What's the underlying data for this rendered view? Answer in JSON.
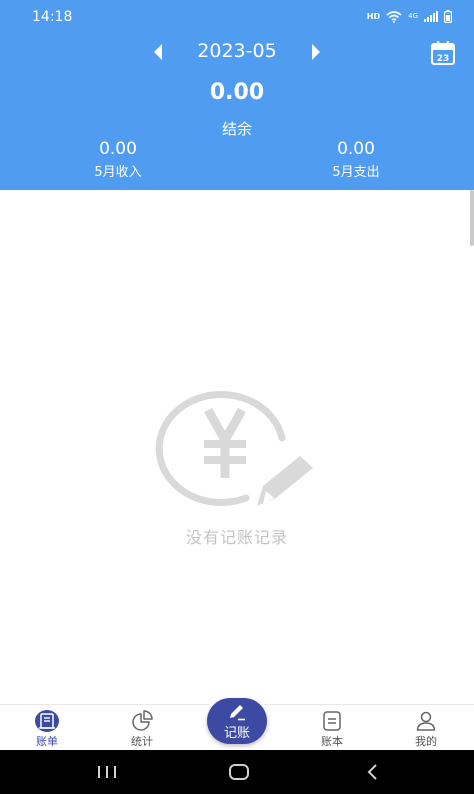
{
  "status_bar": {
    "time": "14:18",
    "hd": "HD",
    "network": "4G"
  },
  "header": {
    "month": "2023-05",
    "prev_icon": "triangle-left-icon",
    "next_icon": "triangle-right-icon",
    "calendar_icon": "calendar-icon",
    "calendar_day": "23",
    "balance": {
      "value": "0.00",
      "label": "结余"
    },
    "income": {
      "value": "0.00",
      "label": "5月收入"
    },
    "expense": {
      "value": "0.00",
      "label": "5月支出"
    }
  },
  "empty_state": {
    "icon": "yen-pencil-icon",
    "text": "没有记账记录"
  },
  "tab_bar": {
    "tabs": [
      {
        "label": "账单",
        "icon": "bill-icon",
        "active": true
      },
      {
        "label": "统计",
        "icon": "pie-chart-icon",
        "active": false
      },
      {
        "label": "账本",
        "icon": "ledger-icon",
        "active": false
      },
      {
        "label": "我的",
        "icon": "user-icon",
        "active": false
      }
    ],
    "fab": {
      "label": "记账",
      "icon": "pencil-icon"
    }
  },
  "colors": {
    "header_bg": "#4f9cf0",
    "accent": "#3d4aa3",
    "empty_text": "#c4c4c4"
  }
}
